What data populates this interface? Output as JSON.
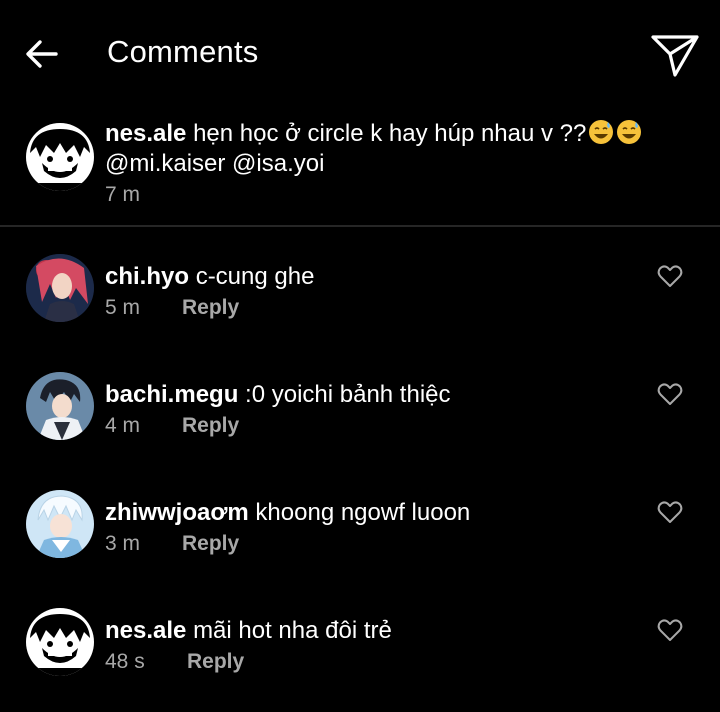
{
  "header": {
    "title": "Comments",
    "back_icon": "arrow-left-icon",
    "send_icon": "paper-plane-icon"
  },
  "caption": {
    "username": "nes.ale",
    "text_line1": "hẹn học ở circle k hay húp nhau v ??",
    "emoji": "😅😅",
    "text_line2": "@mi.kaiser @isa.yoi",
    "time": "7 m"
  },
  "comments": [
    {
      "username": "chi.hyo",
      "text": "c-cung ghe",
      "time": "5 m",
      "reply": "Reply"
    },
    {
      "username": "bachi.megu",
      "text": ":0 yoichi bảnh thiệc",
      "time": "4 m",
      "reply": "Reply"
    },
    {
      "username": "zhiwwjoaơm",
      "text": "khoong ngowf luoon",
      "time": "3 m",
      "reply": "Reply"
    },
    {
      "username": "nes.ale",
      "text": "mãi hot nha đôi trẻ",
      "time": "48 s",
      "reply": "Reply"
    }
  ],
  "colors": {
    "background": "#000000",
    "primary_text": "#ffffff",
    "secondary_text": "#a8a8a8",
    "divider": "#262626"
  }
}
